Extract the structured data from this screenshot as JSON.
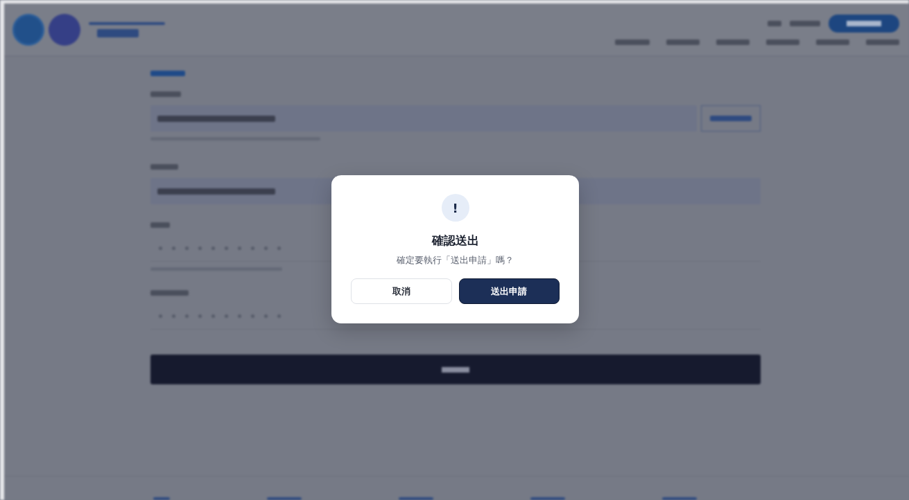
{
  "dialog": {
    "icon": "!",
    "title": "確認送出",
    "message": "確定要執行「送出申請」嗎？",
    "buttons": [
      {
        "label": "取消",
        "kind": "secondary"
      },
      {
        "label": "送出申請",
        "kind": "primary"
      }
    ]
  }
}
